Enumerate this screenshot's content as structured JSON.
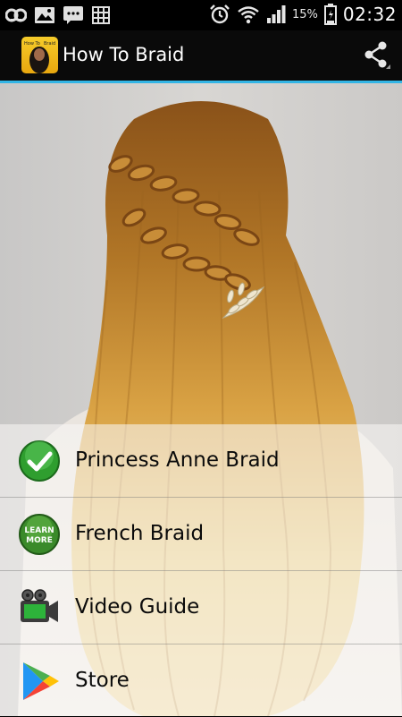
{
  "status_bar": {
    "battery": "15%",
    "time": "02:32"
  },
  "app_bar": {
    "title": "How To Braid",
    "icon_caption": "How To Braid"
  },
  "menu": [
    {
      "label": "Princess Anne Braid",
      "icon": "checkmark-icon"
    },
    {
      "label": "French Braid",
      "icon": "learn-more-icon"
    },
    {
      "label": "Video Guide",
      "icon": "video-camera-icon"
    },
    {
      "label": "Store",
      "icon": "play-store-icon"
    }
  ],
  "colors": {
    "accent": "#33b5e5",
    "app_bar": "#0a0a0a",
    "menu_text": "#0b0b0b",
    "status_bar": "#000000"
  }
}
